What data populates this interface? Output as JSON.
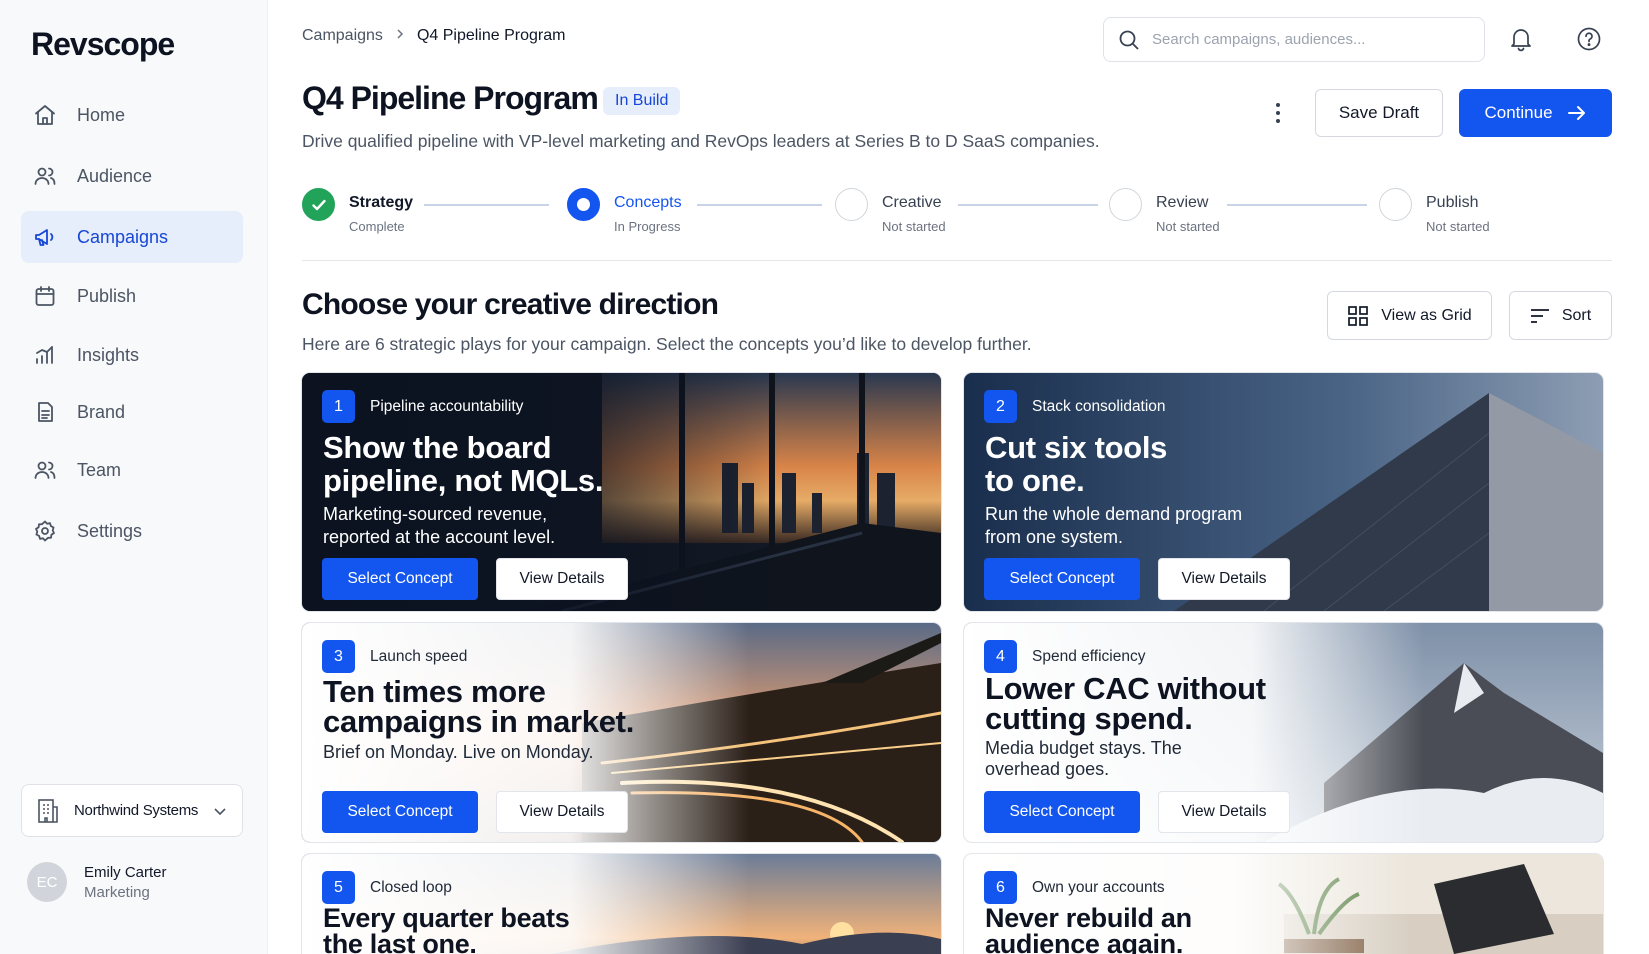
{
  "app": {
    "name": "Revscope"
  },
  "sidebar": {
    "items": [
      {
        "label": "Home",
        "icon": "home-icon"
      },
      {
        "label": "Audience",
        "icon": "users-icon"
      },
      {
        "label": "Campaigns",
        "icon": "megaphone-icon",
        "active": true
      },
      {
        "label": "Publish",
        "icon": "calendar-icon"
      },
      {
        "label": "Insights",
        "icon": "bar-chart-icon"
      },
      {
        "label": "Brand",
        "icon": "document-icon"
      },
      {
        "label": "Team",
        "icon": "users-icon"
      },
      {
        "label": "Settings",
        "icon": "gear-icon"
      }
    ],
    "org": {
      "name": "Northwind Systems",
      "icon": "building-icon"
    },
    "user": {
      "initials": "EC",
      "name": "Emily Carter",
      "role": "Marketing"
    }
  },
  "header": {
    "breadcrumb": [
      "Campaigns",
      "Q4 Pipeline Program"
    ],
    "search_placeholder": "Search campaigns, audiences...",
    "title": "Q4 Pipeline Program",
    "status_badge": "In Build",
    "subtitle": "Drive qualified pipeline with VP-level marketing and RevOps leaders at Series B to D SaaS companies.",
    "save_draft_label": "Save Draft",
    "continue_label": "Continue"
  },
  "steps": [
    {
      "label": "Strategy",
      "status": "Complete",
      "state": "done"
    },
    {
      "label": "Concepts",
      "status": "In Progress",
      "state": "current"
    },
    {
      "label": "Creative",
      "status": "Not started",
      "state": "todo"
    },
    {
      "label": "Review",
      "status": "Not started",
      "state": "todo"
    },
    {
      "label": "Publish",
      "status": "Not started",
      "state": "todo"
    }
  ],
  "section": {
    "title": "Choose your creative direction",
    "subtitle": "Here are 6 strategic plays for your campaign. Select the concepts you’d like to develop further.",
    "view_label": "View as Grid",
    "sort_label": "Sort"
  },
  "concepts": [
    {
      "num": "1",
      "tag": "Pipeline accountability",
      "headline": "Show the board pipeline, not MQLs.",
      "body": "Marketing-sourced revenue, reported at the account level.",
      "select_label": "Select Concept",
      "details_label": "View Details"
    },
    {
      "num": "2",
      "tag": "Stack consolidation",
      "headline": "Cut six tools to one.",
      "body": "Run the whole demand program from one system.",
      "select_label": "Select Concept",
      "details_label": "View Details"
    },
    {
      "num": "3",
      "tag": "Launch speed",
      "headline": "Ten times more campaigns in market.",
      "body": "Brief on Monday. Live on Monday.",
      "select_label": "Select Concept",
      "details_label": "View Details"
    },
    {
      "num": "4",
      "tag": "Spend efficiency",
      "headline": "Lower CAC without cutting spend.",
      "body": "Media budget stays. The overhead goes.",
      "select_label": "Select Concept",
      "details_label": "View Details"
    },
    {
      "num": "5",
      "tag": "Closed loop",
      "headline": "Every quarter beats the last one."
    },
    {
      "num": "6",
      "tag": "Own your accounts",
      "headline": "Never rebuild an audience again."
    }
  ],
  "colors": {
    "accent": "#1355ef",
    "success": "#22a35a",
    "active_bg": "#e6edfb"
  }
}
